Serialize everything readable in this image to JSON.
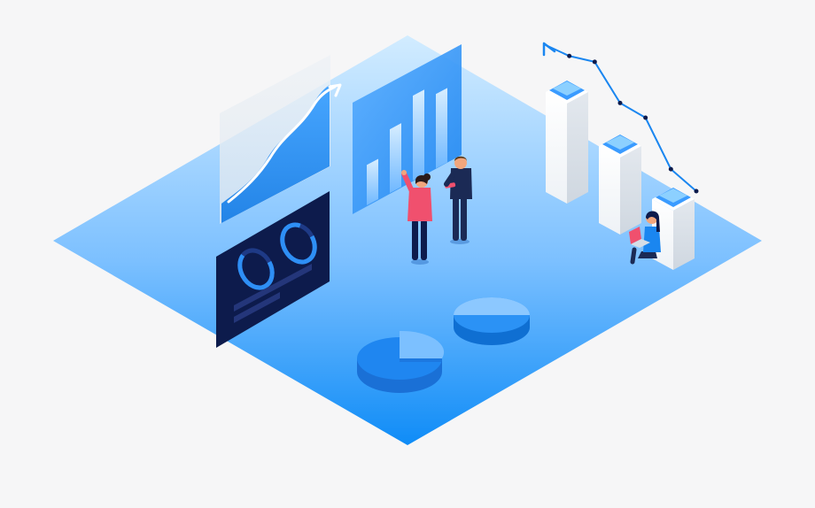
{
  "colors": {
    "background": "#f6f6f7",
    "floor_top": "#c6e5ff",
    "floor_bottom": "#0f8cf7",
    "panel_dark": "#0d1b4c",
    "accent": "#1a86f0",
    "skin": "#f1a67d",
    "shirt_pink": "#f0506e",
    "navy": "#1b2a55"
  },
  "icons": [
    "line-chart-panel",
    "bar-chart-panel",
    "donut-gauge-panel",
    "pie-chart-icon",
    "column-bars",
    "trend-arrow",
    "person-icon",
    "laptop-icon"
  ],
  "illustration": {
    "bar_chart_levels": [
      0.38,
      0.6,
      0.8,
      0.7
    ],
    "donut_levels": [
      0.7,
      0.85
    ],
    "pie_slice_fraction": 0.25,
    "trend_points": [
      1.0,
      0.92,
      0.88,
      0.6,
      0.5,
      0.15,
      0.0
    ]
  }
}
